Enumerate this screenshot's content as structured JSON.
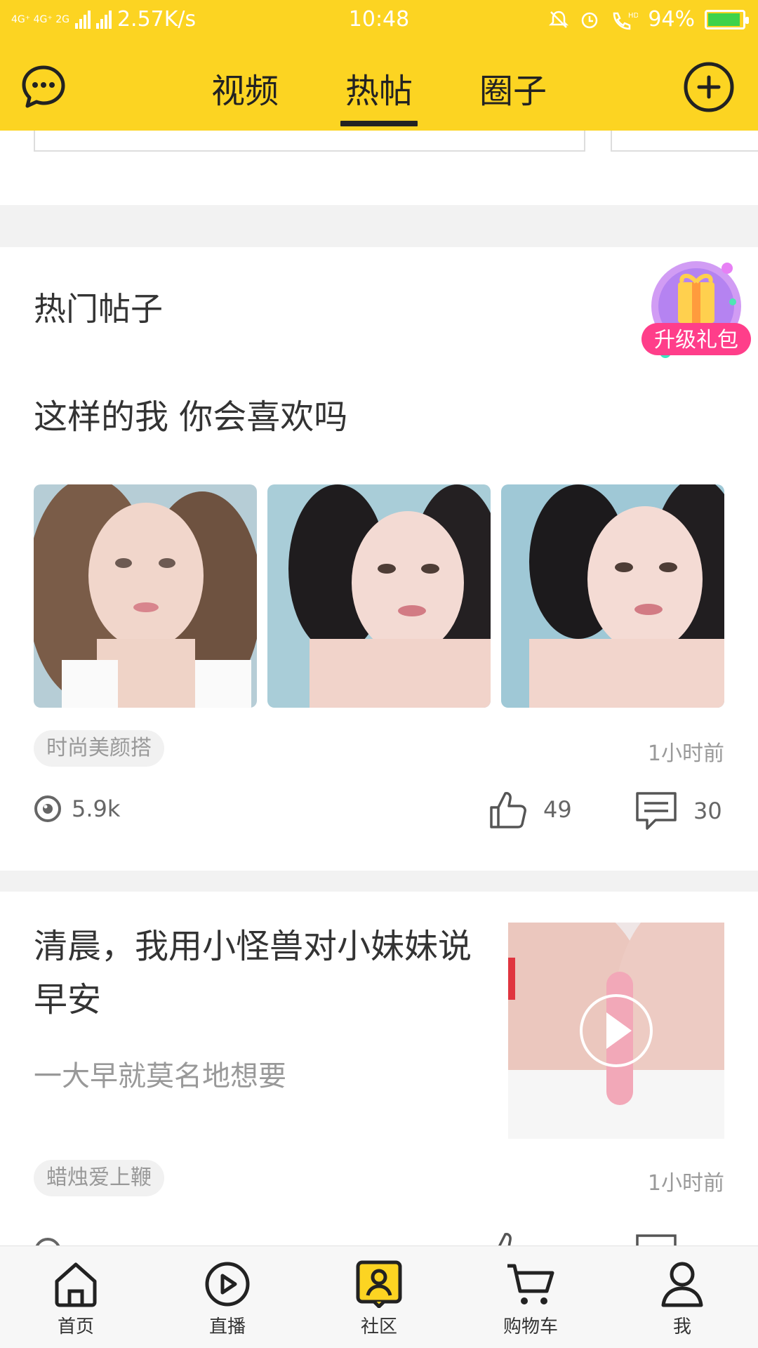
{
  "status_bar": {
    "network_left": "4G⁺ 4G⁺ 2G",
    "speed": "2.57K/s",
    "time": "10:48",
    "battery": "94%",
    "battery_level": 0.94
  },
  "header": {
    "tabs": [
      {
        "label": "视频",
        "active": false
      },
      {
        "label": "热帖",
        "active": true
      },
      {
        "label": "圈子",
        "active": false
      }
    ],
    "icons": {
      "left": "chat-bubble-icon",
      "right": "plus-circle-icon"
    }
  },
  "section": {
    "title": "热门帖子",
    "gift_badge": "升级礼包"
  },
  "posts": [
    {
      "title": "这样的我 你会喜欢吗",
      "tag": "时尚美颜搭",
      "time": "1小时前",
      "views": "5.9k",
      "likes": "49",
      "comments": "30"
    },
    {
      "title": "清晨，我用小怪兽对小妹妹说早安",
      "subtitle": "一大早就莫名地想要",
      "tag": "蜡烛爱上鞭",
      "time": "1小时前"
    }
  ],
  "bottom_nav": [
    {
      "label": "首页",
      "icon": "home-icon"
    },
    {
      "label": "直播",
      "icon": "play-icon"
    },
    {
      "label": "社区",
      "icon": "community-icon",
      "active": true
    },
    {
      "label": "购物车",
      "icon": "cart-icon"
    },
    {
      "label": "我",
      "icon": "profile-icon"
    }
  ],
  "colors": {
    "accent": "#FCD422",
    "text": "#333333",
    "muted": "#999999",
    "separator": "#F2F2F2"
  }
}
